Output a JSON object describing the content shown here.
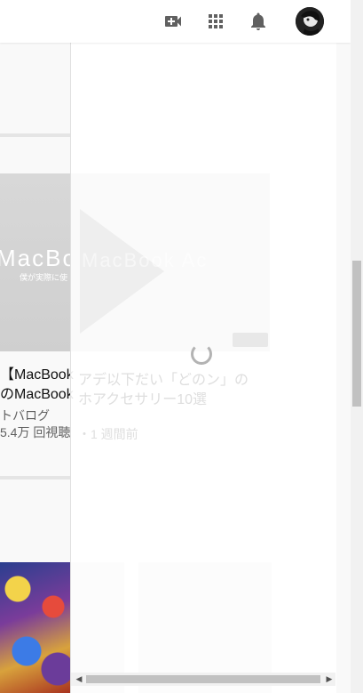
{
  "header": {
    "icons": [
      "video-create-icon",
      "apps-grid-icon",
      "notifications-bell-icon"
    ],
    "avatar": "user-avatar"
  },
  "videos": [
    {
      "thumb_title": "MacBo",
      "thumb_subtitle": "僕が実際に使",
      "title_line1": "【MacBook",
      "title_line2": "のMacBook",
      "channel": "トバログ",
      "views": "5.4万 回視聴"
    }
  ],
  "overlay": {
    "faded_title_line1": "アデ以下だい「どのン」の",
    "faded_title_line2": "ホアクセサリー10選",
    "faded_meta": "・1 週間前",
    "thumb_text": "MacBook Ac"
  },
  "colors": {
    "header_bg": "#ffffff",
    "page_bg": "#f9f9f9",
    "scroll_thumb": "#c1c1c1"
  }
}
